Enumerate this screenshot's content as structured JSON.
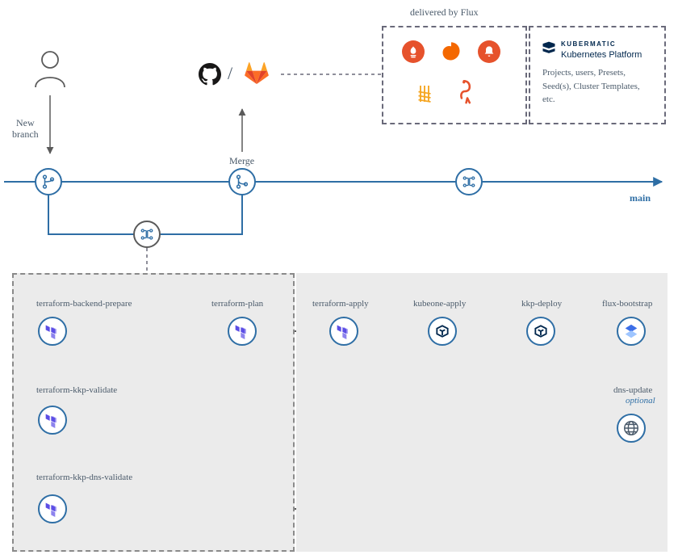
{
  "labels": {
    "delivered": "delivered by Flux",
    "newBranch": "New\nbranch",
    "merge": "Merge",
    "main": "main",
    "kubermaticShort": "KUBERMATIC",
    "kubermaticSub": "Kubernetes Platform",
    "kubermaticDesc": "Projects, users, Presets,\nSeed(s), Cluster Templates,\netc.",
    "tfBackend": "terraform-backend-prepare",
    "tfPlan": "terraform-plan",
    "tfApply": "terraform-apply",
    "kubeoneApply": "kubeone-apply",
    "kkpDeploy": "kkp-deploy",
    "fluxBootstrap": "flux-bootstrap",
    "tfKkpValidate": "terraform-kkp-validate",
    "dnsUpdate": "dns-update",
    "optional": "optional",
    "tfKkpDns": "terraform-kkp-dns-validate"
  },
  "icons": {
    "user": "user",
    "github": "github",
    "gitlab": "gitlab",
    "branch": "branch",
    "mergeIcon": "merge",
    "ciCd": "ci-cd",
    "prometheus": "prometheus",
    "grafana": "grafana",
    "alert": "alert",
    "loki": "loki",
    "custom": "custom",
    "kubermatic": "kubermatic",
    "terraform": "terraform",
    "globe": "globe",
    "layers": "layers"
  }
}
